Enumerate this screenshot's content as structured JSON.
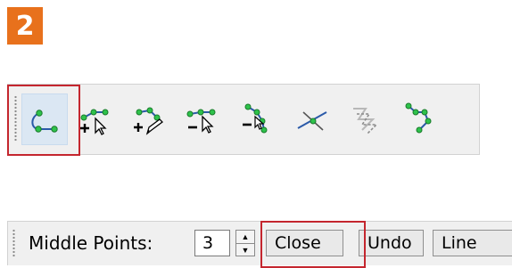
{
  "step_badge": {
    "text": "2",
    "color": "#e8711c"
  },
  "toolbar": {
    "tools": [
      {
        "icon": "new-line-icon",
        "selected": true
      },
      {
        "icon": "add-vertex-icon",
        "selected": false
      },
      {
        "icon": "add-vertex-pen-icon",
        "selected": false
      },
      {
        "icon": "remove-vertex-icon",
        "selected": false
      },
      {
        "icon": "remove-vertex-alt-icon",
        "selected": false
      },
      {
        "icon": "split-line-icon",
        "selected": false
      },
      {
        "icon": "parallel-line-icon",
        "selected": false
      },
      {
        "icon": "polyline-icon",
        "selected": false
      }
    ]
  },
  "bottombar": {
    "middle_points_label": "Middle Points:",
    "middle_points_value": "3",
    "close_label": "Close",
    "undo_label": "Undo",
    "line_label": "Line"
  },
  "highlight_color": "#c4262e"
}
